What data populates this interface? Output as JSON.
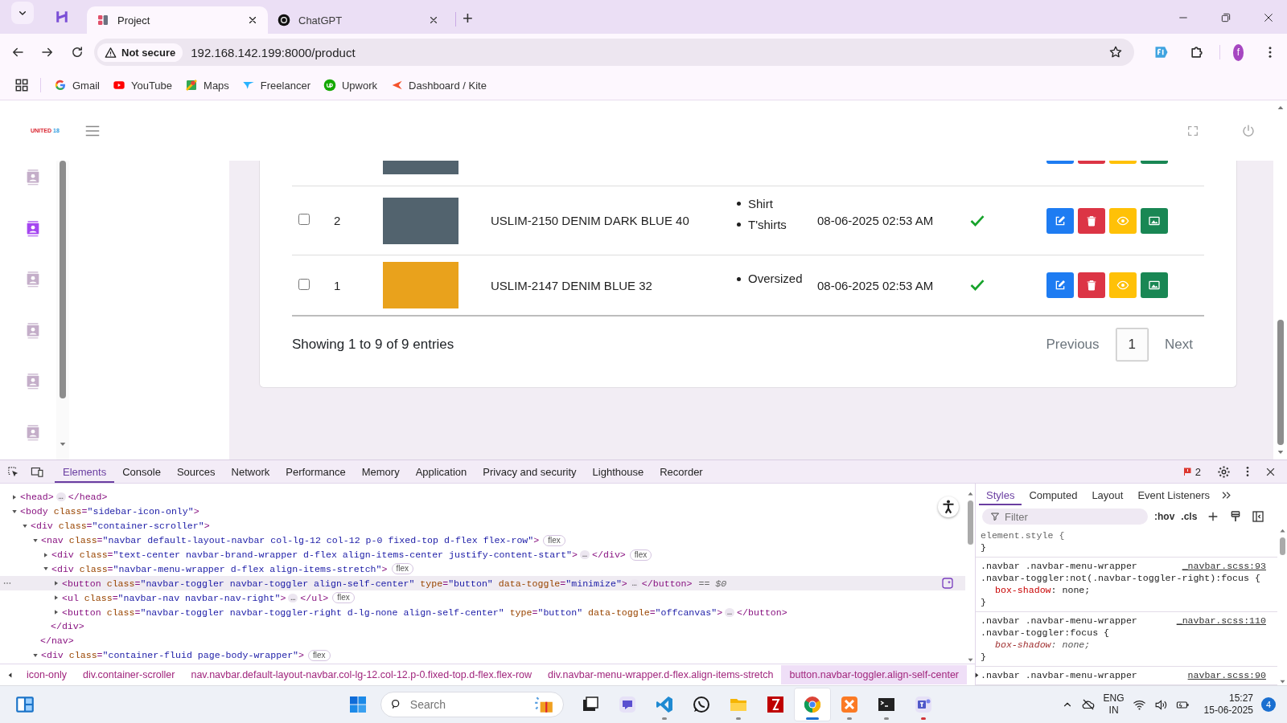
{
  "browser": {
    "tabs": [
      {
        "title": "Project",
        "selected": true
      },
      {
        "title": "ChatGPT",
        "selected": false
      }
    ],
    "new_tab": "+",
    "security": "Not secure",
    "url": "192.168.142.199:8000/product",
    "profile": "f",
    "bookmarks": [
      "Gmail",
      "YouTube",
      "Maps",
      "Freelancer",
      "Upwork",
      "Dashboard / Kite"
    ]
  },
  "app": {
    "logo": [
      "UNITED",
      "18"
    ],
    "sidebar": [
      {
        "selected": false
      },
      {
        "selected": true
      },
      {
        "selected": false
      },
      {
        "selected": false
      },
      {
        "selected": false
      },
      {
        "selected": false
      }
    ],
    "rows": [
      {
        "kind": "cut",
        "color": "#52636e"
      },
      {
        "kind": "full",
        "checked": false,
        "number": "2",
        "name": "USLIM-2150 DENIM DARK BLUE 40",
        "categories": [
          "Shirt",
          "T'shirts"
        ],
        "date": "08-06-2025 02:53 AM",
        "active": true,
        "color": "#52636e"
      },
      {
        "kind": "full",
        "checked": false,
        "number": "1",
        "name": "USLIM-2147 DENIM BLUE 32",
        "categories": [
          "Oversized"
        ],
        "date": "08-06-2025 02:53 AM",
        "active": true,
        "color": "#e9a21c"
      }
    ],
    "summary": "Showing 1 to 9 of 9 entries",
    "pages": [
      {
        "label": "Previous",
        "kind": "nav",
        "selected": false
      },
      {
        "label": "1",
        "kind": "page",
        "selected": true
      },
      {
        "label": "Next",
        "kind": "nav",
        "selected": false
      }
    ]
  },
  "devtools": {
    "tabs": [
      {
        "label": "Elements",
        "selected": true
      },
      {
        "label": "Console",
        "selected": false
      },
      {
        "label": "Sources",
        "selected": false
      },
      {
        "label": "Network",
        "selected": false
      },
      {
        "label": "Performance",
        "selected": false
      },
      {
        "label": "Memory",
        "selected": false
      },
      {
        "label": "Application",
        "selected": false
      },
      {
        "label": "Privacy and security",
        "selected": false
      },
      {
        "label": "Lighthouse",
        "selected": false
      },
      {
        "label": "Recorder",
        "selected": false
      }
    ],
    "issues": "2",
    "dom_tree": [
      {
        "open": "<head>",
        "more": "…",
        "close": "</head>",
        "expanded": false,
        "selected": false
      },
      {
        "open": "<body class=\"sidebar-icon-only\">",
        "expanded": true,
        "selected": false,
        "children": [
          {
            "open": "<div class=\"container-scroller\">",
            "expanded": true,
            "selected": false,
            "children": [
              {
                "open": "<nav class=\"navbar default-layout-navbar col-lg-12 col-12 p-0 fixed-top d-flex flex-row\">",
                "badge": "flex",
                "expanded": true,
                "selected": false,
                "end": "</nav>",
                "children": [
                  {
                    "open": "<div class=\"text-center navbar-brand-wrapper d-flex align-items-center justify-content-start\">",
                    "more": "…",
                    "close": "</div>",
                    "badge": "flex",
                    "expanded": false,
                    "selected": false
                  },
                  {
                    "open": "<div class=\"navbar-menu-wrapper d-flex align-items-stretch\">",
                    "badge": "flex",
                    "expanded": true,
                    "selected": false,
                    "end": "</div>",
                    "children": [
                      {
                        "open": "<button class=\"navbar-toggler navbar-toggler align-self-center\" type=\"button\" data-toggle=\"minimize\">",
                        "more": "…",
                        "close": "</button>",
                        "suffix": "== $0",
                        "expanded": false,
                        "selected": true
                      },
                      {
                        "open": "<ul class=\"navbar-nav navbar-nav-right\">",
                        "more": "…",
                        "close": "</ul>",
                        "badge": "flex",
                        "expanded": false,
                        "selected": false
                      },
                      {
                        "open": "<button class=\"navbar-toggler navbar-toggler-right d-lg-none align-self-center\" type=\"button\" data-toggle=\"offcanvas\">",
                        "more": "…",
                        "close": "</button>",
                        "expanded": false,
                        "selected": false
                      }
                    ]
                  }
                ]
              },
              {
                "open": "<div class=\"container-fluid page-body-wrapper\">",
                "badge": "flex",
                "expanded": true,
                "selected": false
              }
            ]
          }
        ]
      }
    ],
    "breadcrumbs": [
      {
        "label": "icon-only",
        "selected": false
      },
      {
        "label": "div.container-scroller",
        "selected": false
      },
      {
        "label": "nav.navbar.default-layout-navbar.col-lg-12.col-12.p-0.fixed-top.d-flex.flex-row",
        "selected": false
      },
      {
        "label": "div.navbar-menu-wrapper.d-flex.align-items-stretch",
        "selected": false
      },
      {
        "label": "button.navbar-toggler.align-self-center",
        "selected": true
      }
    ],
    "style_tabs": [
      {
        "label": "Styles",
        "selected": true
      },
      {
        "label": "Computed",
        "selected": false
      },
      {
        "label": "Layout",
        "selected": false
      },
      {
        "label": "Event Listeners",
        "selected": false
      }
    ],
    "filter_placeholder": "Filter",
    "hov": ":hov",
    "cls": ".cls",
    "rules": [
      {
        "selectors": [
          "element.style {"
        ],
        "close": "}"
      },
      {
        "selectors": [
          ".navbar .navbar-menu-wrapper",
          ".navbar-toggler:not(.navbar-toggler-right):focus {"
        ],
        "source": "_navbar.scss:93",
        "declarations": [
          {
            "text": "box-shadow: none;",
            "overridden": false
          }
        ],
        "close": "}"
      },
      {
        "selectors": [
          ".navbar .navbar-menu-wrapper",
          ".navbar-toggler:focus {"
        ],
        "source": "_navbar.scss:110",
        "declarations": [
          {
            "text": "box-shadow: none;",
            "overridden": true
          }
        ],
        "close": "}"
      },
      {
        "selectors": [
          ".navbar .navbar-menu-wrapper"
        ],
        "source": "navbar.scss:90"
      }
    ]
  },
  "taskbar": {
    "search_placeholder": "Search",
    "apps": [
      {
        "kind": "taskview",
        "running": false,
        "selected": false
      },
      {
        "kind": "chat",
        "running": false,
        "selected": false
      },
      {
        "kind": "code",
        "running": true,
        "selected": false,
        "color": "#8a8a8a"
      },
      {
        "kind": "whatsapp",
        "running": false,
        "selected": false
      },
      {
        "kind": "folder",
        "running": true,
        "selected": false,
        "color": "#8a8a8a"
      },
      {
        "kind": "ftp",
        "running": false,
        "selected": false
      },
      {
        "kind": "chrome",
        "running": true,
        "selected": true,
        "color": "#1a6fd0"
      },
      {
        "kind": "xampp",
        "running": true,
        "selected": false,
        "color": "#8a8a8a"
      },
      {
        "kind": "terminal",
        "running": true,
        "selected": false,
        "color": "#8a8a8a"
      },
      {
        "kind": "teams",
        "running": true,
        "selected": false,
        "color": "#d13438"
      }
    ],
    "language": [
      "ENG",
      "IN"
    ],
    "time": "15:27",
    "date": "15-06-2025",
    "notifications": "4"
  }
}
